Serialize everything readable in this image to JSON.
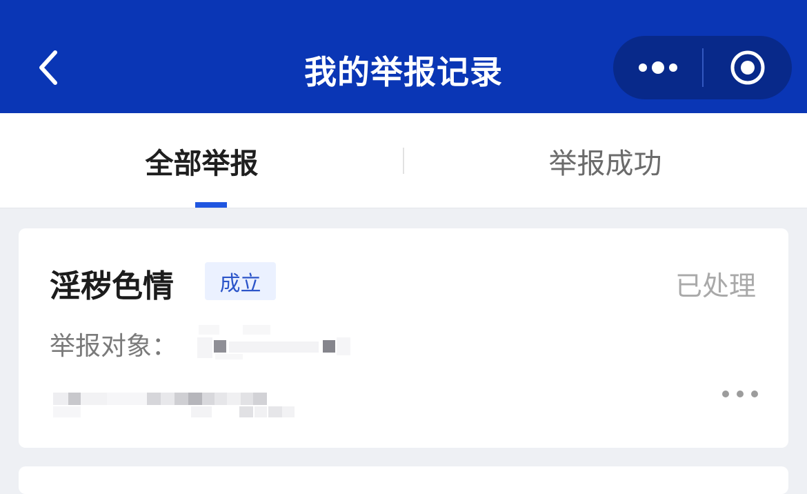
{
  "header": {
    "title": "我的举报记录",
    "back_icon": "chevron-left-icon",
    "more_icon": "more-dots-icon",
    "close_icon": "target-circle-icon",
    "bg_color": "#0a36b5"
  },
  "tabs": [
    {
      "label": "全部举报",
      "active": true
    },
    {
      "label": "举报成功",
      "active": false
    }
  ],
  "record": {
    "category": "淫秽色情",
    "badge": "成立",
    "status": "已处理",
    "target_label": "举报对象：",
    "more_icon": "more-horizontal-icon"
  },
  "colors": {
    "accent": "#1f56e0",
    "badge_bg": "#ebf1ff",
    "badge_text": "#2c55c9",
    "page_bg": "#eef0f4"
  }
}
